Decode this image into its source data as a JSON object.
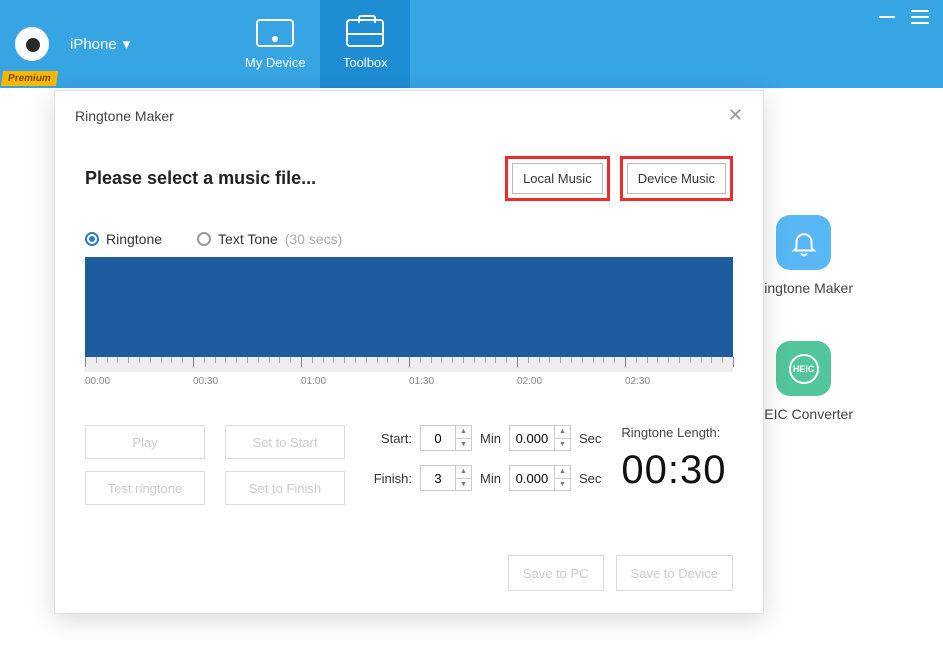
{
  "header": {
    "device_label": "iPhone",
    "premium_badge": "Premium",
    "nav": {
      "my_device": "My Device",
      "toolbox": "Toolbox"
    }
  },
  "side_apps": {
    "ringtone_maker": "Ringtone Maker",
    "heic_converter": "HEIC Converter",
    "heic_badge": "HEIC"
  },
  "modal": {
    "title": "Ringtone Maker",
    "heading": "Please select a music file...",
    "local_music": "Local Music",
    "device_music": "Device Music",
    "opt_ringtone": "Ringtone",
    "opt_texttone": "Text Tone",
    "opt_texttone_sub": "(30 secs)",
    "timeline": [
      "00:00",
      "00:30",
      "01:00",
      "01:30",
      "02:00",
      "02:30"
    ],
    "buttons": {
      "play": "Play",
      "set_start": "Set to Start",
      "test_ringtone": "Test ringtone",
      "set_finish": "Set to Finish",
      "save_pc": "Save to PC",
      "save_device": "Save to Device"
    },
    "labels": {
      "start": "Start:",
      "finish": "Finish:",
      "min": "Min",
      "sec": "Sec",
      "length": "Ringtone Length:"
    },
    "values": {
      "start_min": "0",
      "start_sec": "0.000",
      "finish_min": "3",
      "finish_sec": "0.000",
      "length": "00:30"
    }
  }
}
